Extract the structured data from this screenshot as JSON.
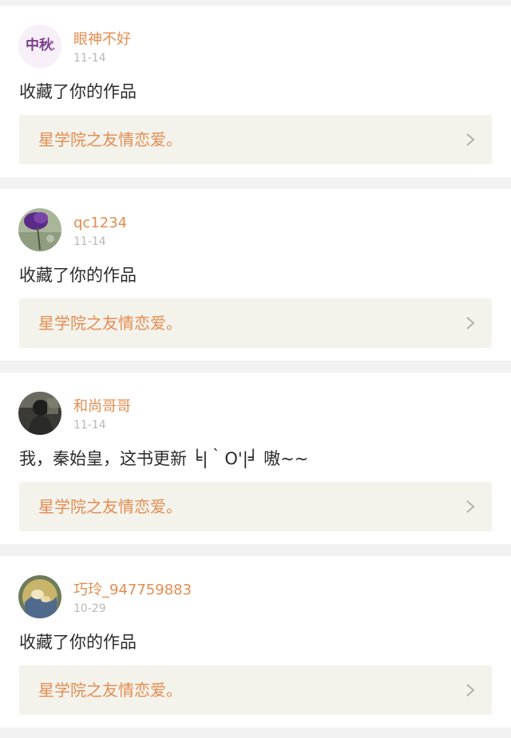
{
  "feed": {
    "items": [
      {
        "username": "眼神不好",
        "date": "11-14",
        "action": "收藏了你的作品",
        "work_title": "星学院之友情恋爱。",
        "avatar_icon": "mid-autumn-calligraphy-avatar",
        "avatar_text": "中秋"
      },
      {
        "username": "qc1234",
        "date": "11-14",
        "action": "收藏了你的作品",
        "work_title": "星学院之友情恋爱。",
        "avatar_icon": "purple-flower-avatar"
      },
      {
        "username": "和尚哥哥",
        "date": "11-14",
        "action": "我，秦始皇，这书更新 ╘|｀O'|╛ 嗷~~",
        "work_title": "星学院之友情恋爱。",
        "avatar_icon": "person-photo-avatar"
      },
      {
        "username": "巧玲_947759883",
        "date": "10-29",
        "action": "收藏了你的作品",
        "work_title": "星学院之友情恋爱。",
        "avatar_icon": "painting-avatar"
      }
    ]
  },
  "colors": {
    "accent": "#e58c50",
    "date": "#b8b8b8",
    "text": "#2b2b2b",
    "link_bg": "#f3f3ec",
    "page_bg": "#f2f2f2"
  }
}
